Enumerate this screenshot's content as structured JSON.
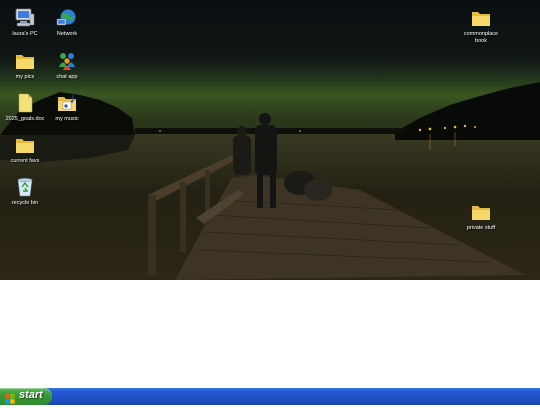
{
  "desktop": {
    "icons": [
      {
        "label": "laura's PC",
        "icon": "computer-icon"
      },
      {
        "label": "Network",
        "icon": "network-icon"
      },
      {
        "label": "my pics",
        "icon": "folder-icon"
      },
      {
        "label": "chat app",
        "icon": "chat-icon"
      },
      {
        "label": "2025_goals.doc",
        "icon": "document-icon"
      },
      {
        "label": "my music",
        "icon": "music-folder-icon"
      },
      {
        "label": "current favs",
        "icon": "folder-icon"
      },
      {
        "label": "recycle bin",
        "icon": "recycle-bin-icon"
      },
      {
        "label": "commonplace book",
        "icon": "folder-icon"
      },
      {
        "label": "private stuff",
        "icon": "folder-icon"
      }
    ]
  },
  "taskbar": {
    "start_label": "start"
  },
  "colors": {
    "taskbar_blue": "#2458d4",
    "start_green": "#3a9a36",
    "folder_yellow": "#f2d35a"
  }
}
